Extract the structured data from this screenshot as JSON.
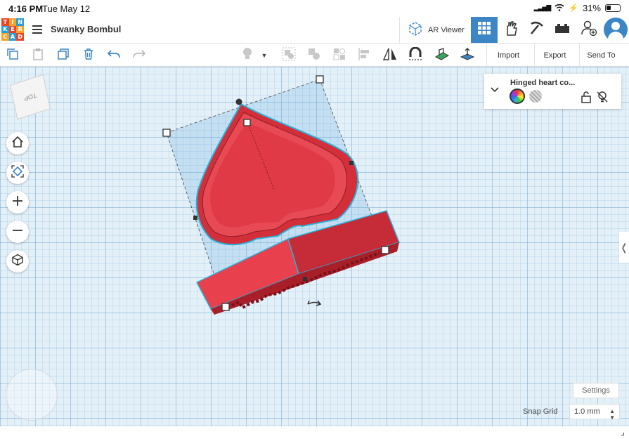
{
  "status": {
    "time": "4:16 PM",
    "date": "Tue May 12",
    "battery": "31%"
  },
  "header": {
    "logo_letters": [
      "T",
      "I",
      "N",
      "K",
      "E",
      "R",
      "C",
      "A",
      "D"
    ],
    "logo_colors": [
      "#e8452c",
      "#f6a229",
      "#2a9fd6",
      "#2a9fd6",
      "#e8452c",
      "#f6a229",
      "#f6a229",
      "#2a9fd6",
      "#e8452c"
    ],
    "project_title": "Swanky Bombul",
    "ar_viewer_label": "AR Viewer",
    "accent": "#3d86c6"
  },
  "toolbar": {
    "import_label": "Import",
    "export_label": "Export",
    "send_to_label": "Send To"
  },
  "viewcube": {
    "label": "TOP"
  },
  "inspector": {
    "shape_name": "Hinged heart co..."
  },
  "workplane": {
    "shape_color": "#e23b44",
    "settings_label": "Settings",
    "snap_grid_label": "Snap Grid",
    "snap_grid_value": "1.0 mm"
  }
}
